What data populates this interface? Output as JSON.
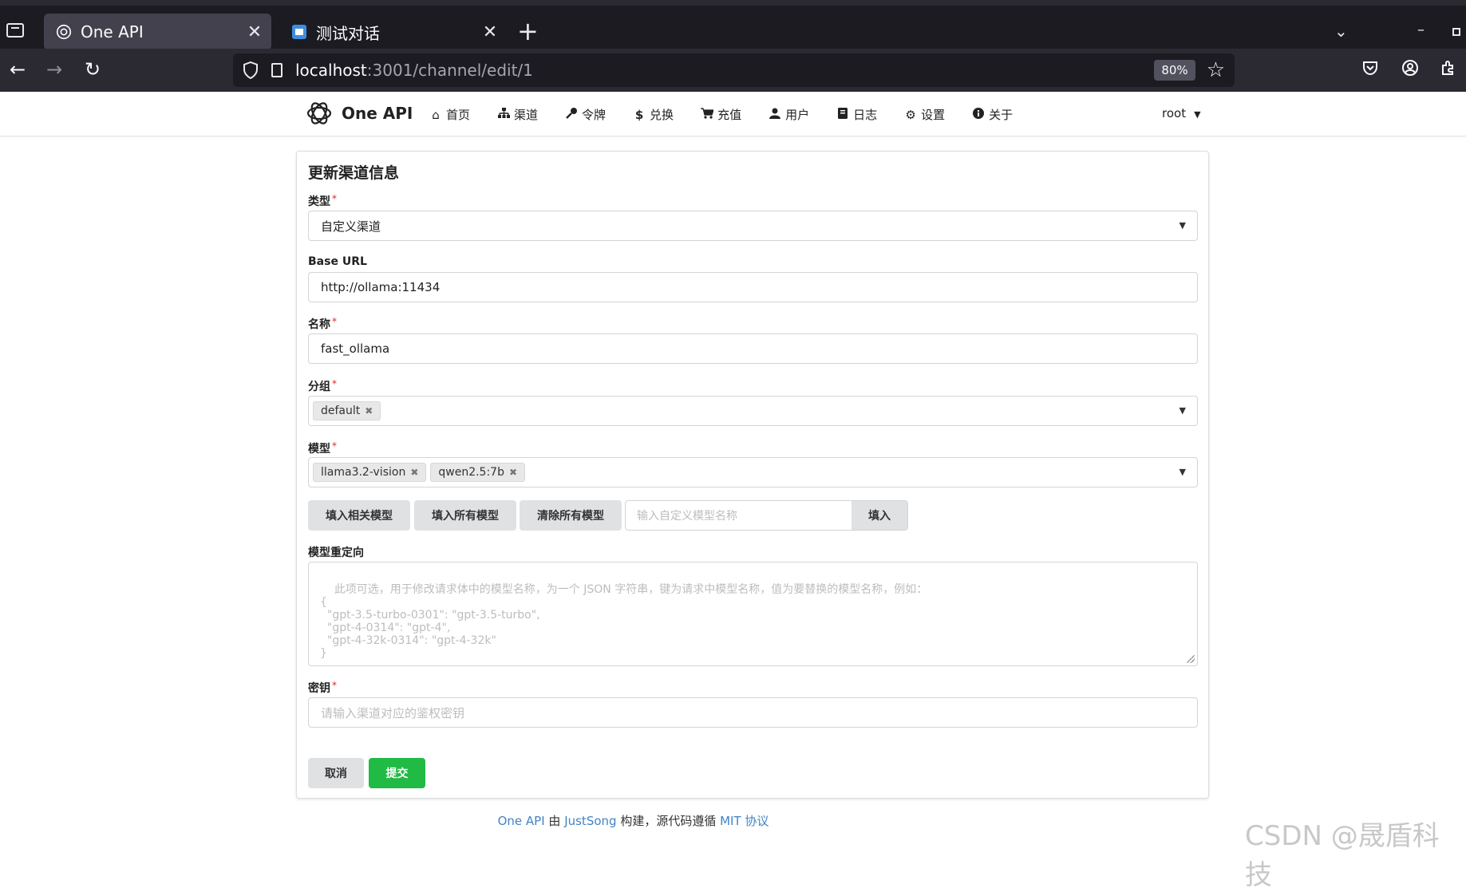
{
  "browser": {
    "tabs": [
      {
        "title": "One API",
        "active": true
      },
      {
        "title": "测试对话",
        "active": false
      }
    ],
    "url_host": "localhost",
    "url_rest": ":3001/channel/edit/1",
    "zoom": "80%"
  },
  "app": {
    "brand": "One API",
    "menu": [
      {
        "label": "首页",
        "icon": "home-icon"
      },
      {
        "label": "渠道",
        "icon": "sitemap-icon"
      },
      {
        "label": "令牌",
        "icon": "key-icon"
      },
      {
        "label": "兑换",
        "icon": "dollar-icon"
      },
      {
        "label": "充值",
        "icon": "cart-icon"
      },
      {
        "label": "用户",
        "icon": "user-icon"
      },
      {
        "label": "日志",
        "icon": "book-icon"
      },
      {
        "label": "设置",
        "icon": "gear-icon"
      },
      {
        "label": "关于",
        "icon": "info-icon"
      }
    ],
    "user": "root"
  },
  "form": {
    "title": "更新渠道信息",
    "type_label": "类型",
    "type_value": "自定义渠道",
    "base_url_label": "Base URL",
    "base_url_value": "http://ollama:11434",
    "name_label": "名称",
    "name_value": "fast_ollama",
    "group_label": "分组",
    "groups": [
      "default"
    ],
    "model_label": "模型",
    "models": [
      "llama3.2-vision",
      "qwen2.5:7b"
    ],
    "fill_related_label": "填入相关模型",
    "fill_all_label": "填入所有模型",
    "clear_all_label": "清除所有模型",
    "custom_model_placeholder": "输入自定义模型名称",
    "custom_model_fill_label": "填入",
    "mapping_label": "模型重定向",
    "mapping_placeholder": "此项可选，用于修改请求体中的模型名称，为一个 JSON 字符串，键为请求中模型名称，值为要替换的模型名称，例如：\n{\n  \"gpt-3.5-turbo-0301\": \"gpt-3.5-turbo\",\n  \"gpt-4-0314\": \"gpt-4\",\n  \"gpt-4-32k-0314\": \"gpt-4-32k\"\n}",
    "key_label": "密钥",
    "key_placeholder": "请输入渠道对应的鉴权密钥",
    "cancel_label": "取消",
    "submit_label": "提交"
  },
  "footer": {
    "link1": "One API",
    "text1": " 由 ",
    "link2": "JustSong",
    "text2": " 构建，源代码遵循 ",
    "link3": "MIT 协议"
  },
  "watermark": "CSDN @晟盾科技",
  "colors": {
    "submit": "#21ba45",
    "link": "#4183c4",
    "required": "#db2828"
  }
}
